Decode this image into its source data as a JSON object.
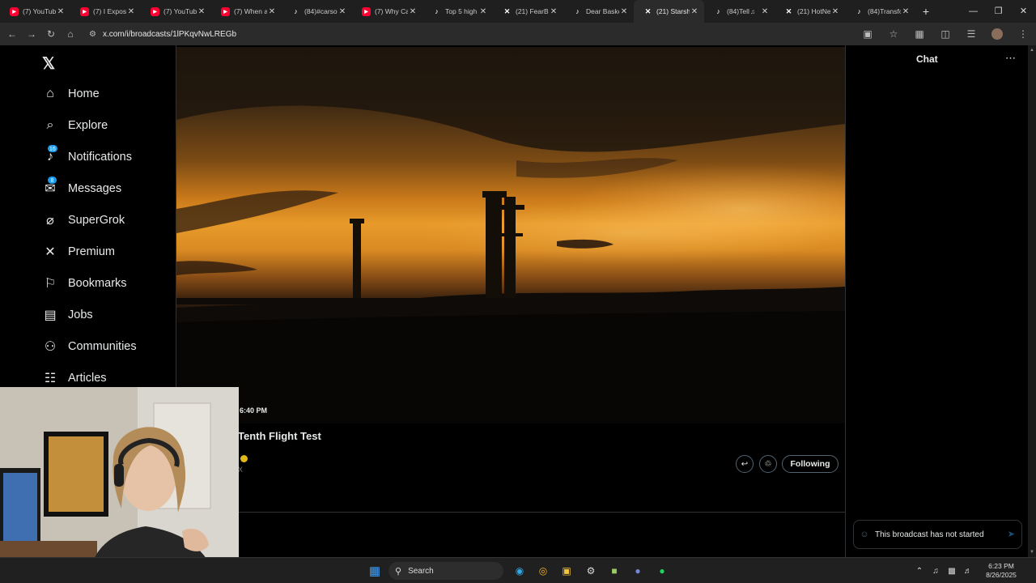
{
  "browser": {
    "tabs": [
      {
        "title": "(7) YouTube",
        "icon": "youtube-icon",
        "kind": "yt"
      },
      {
        "title": "(7) I Exposed",
        "icon": "youtube-icon",
        "kind": "yt"
      },
      {
        "title": "(7) YouTube",
        "icon": "youtube-icon",
        "kind": "yt"
      },
      {
        "title": "(7) When a",
        "icon": "youtube-icon",
        "kind": "yt"
      },
      {
        "title": "(84)#carson",
        "icon": "tiktok-icon",
        "kind": "tt"
      },
      {
        "title": "(7) Why Ca",
        "icon": "youtube-icon",
        "kind": "yt"
      },
      {
        "title": "Top 5 high",
        "icon": "tiktok-icon",
        "kind": "tt"
      },
      {
        "title": "(21) FearBu",
        "icon": "x-icon",
        "kind": "x"
      },
      {
        "title": "Dear Baske",
        "icon": "tiktok-icon",
        "kind": "tt"
      },
      {
        "title": "(21) Starsh",
        "icon": "x-icon",
        "kind": "x",
        "active": true
      },
      {
        "title": "(84)Tell",
        "icon": "tiktok-icon",
        "kind": "tt",
        "audio": true
      },
      {
        "title": "(21) HotNe",
        "icon": "x-icon",
        "kind": "x"
      },
      {
        "title": "(84)Transfo",
        "icon": "tiktok-icon",
        "kind": "tt"
      }
    ],
    "url": "x.com/i/broadcasts/1lPKqvNwLREGb"
  },
  "nav": {
    "items": [
      {
        "label": "Home",
        "icon": "home-icon"
      },
      {
        "label": "Explore",
        "icon": "search-icon"
      },
      {
        "label": "Notifications",
        "icon": "bell-icon",
        "badge": "16"
      },
      {
        "label": "Messages",
        "icon": "envelope-icon",
        "badge": "8"
      },
      {
        "label": "SuperGrok",
        "icon": "grok-icon"
      },
      {
        "label": "Premium",
        "icon": "x-icon"
      },
      {
        "label": "Bookmarks",
        "icon": "bookmark-icon"
      },
      {
        "label": "Jobs",
        "icon": "briefcase-icon"
      },
      {
        "label": "Communities",
        "icon": "people-icon"
      },
      {
        "label": "Articles",
        "icon": "article-icon"
      }
    ]
  },
  "broadcast": {
    "time": "6:40 PM",
    "title": "Tenth Flight Test",
    "handle": "X",
    "follow_label": "Following"
  },
  "chat": {
    "title": "Chat",
    "placeholder": "This broadcast has not started"
  },
  "taskbar": {
    "search_label": "Search",
    "time": "6:23 PM",
    "date": "8/26/2025"
  },
  "colors": {
    "accent": "#1d9bf0",
    "background": "#000000",
    "verified": "#e2b719"
  }
}
